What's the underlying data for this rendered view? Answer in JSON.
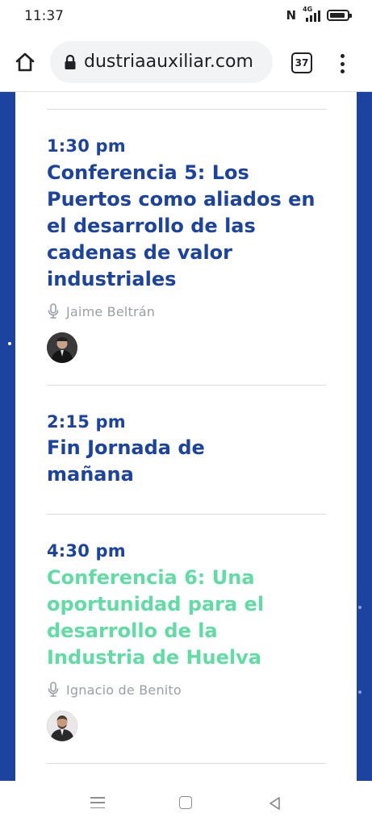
{
  "status_bar": {
    "time": "11:37",
    "network_label": "4G",
    "icons": [
      "nfc-icon",
      "signal-icon",
      "battery-icon"
    ]
  },
  "browser": {
    "url": "dustriaauxiliar.com",
    "tab_count": "37",
    "icons": [
      "home-icon",
      "lock-icon",
      "tabs-icon",
      "more-vert-icon"
    ]
  },
  "colors": {
    "brand_blue": "#1d43a0",
    "accent_green": "#62dca5",
    "speaker_gray": "#9a9fa8"
  },
  "schedule": [
    {
      "time": "1:30 pm",
      "title": "Conferencia 5: Los Puertos como aliados en el desarrollo de las cadenas de valor industriales",
      "speaker": "Jaime Beltrán",
      "highlight": false
    },
    {
      "time": "2:15 pm",
      "title": "Fin Jornada de mañana",
      "speaker": "",
      "highlight": false
    },
    {
      "time": "4:30 pm",
      "title": "Conferencia 6: Una oportunidad para el desarrollo de la Industria de Huelva",
      "speaker": "Ignacio de Benito",
      "highlight": true
    }
  ],
  "nav_bar": {
    "icons": [
      "recents-menu-icon",
      "home-square-icon",
      "back-triangle-icon"
    ]
  }
}
